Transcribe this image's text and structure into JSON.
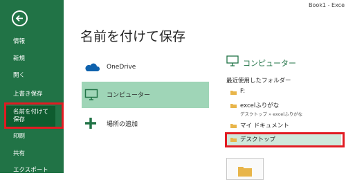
{
  "window": {
    "title": "Book1 - Exce"
  },
  "sidebar": {
    "items": [
      {
        "label": "情報"
      },
      {
        "label": "新規"
      },
      {
        "label": "開く"
      },
      {
        "label": "上書き保存"
      },
      {
        "label_line1": "名前を付けて",
        "label_line2": "保存"
      },
      {
        "label": "印刷"
      },
      {
        "label": "共有"
      },
      {
        "label": "エクスポート"
      }
    ]
  },
  "page": {
    "title": "名前を付けて保存"
  },
  "locations": [
    {
      "label": "OneDrive",
      "icon": "cloud-icon"
    },
    {
      "label": "コンピューター",
      "icon": "computer-icon"
    },
    {
      "label": "場所の追加",
      "icon": "plus-icon"
    }
  ],
  "right_panel": {
    "title": "コンピューター",
    "recent_label": "最近使用したフォルダー",
    "folders": [
      {
        "name": "F:"
      },
      {
        "name": "excelふりがな",
        "path": "デスクトップ » excelふりがな"
      },
      {
        "name": "マイ ドキュメント"
      },
      {
        "name": "デスクトップ"
      }
    ]
  },
  "colors": {
    "accent": "#217346",
    "highlight": "#e11b22",
    "active_location": "#9fd5b7"
  }
}
